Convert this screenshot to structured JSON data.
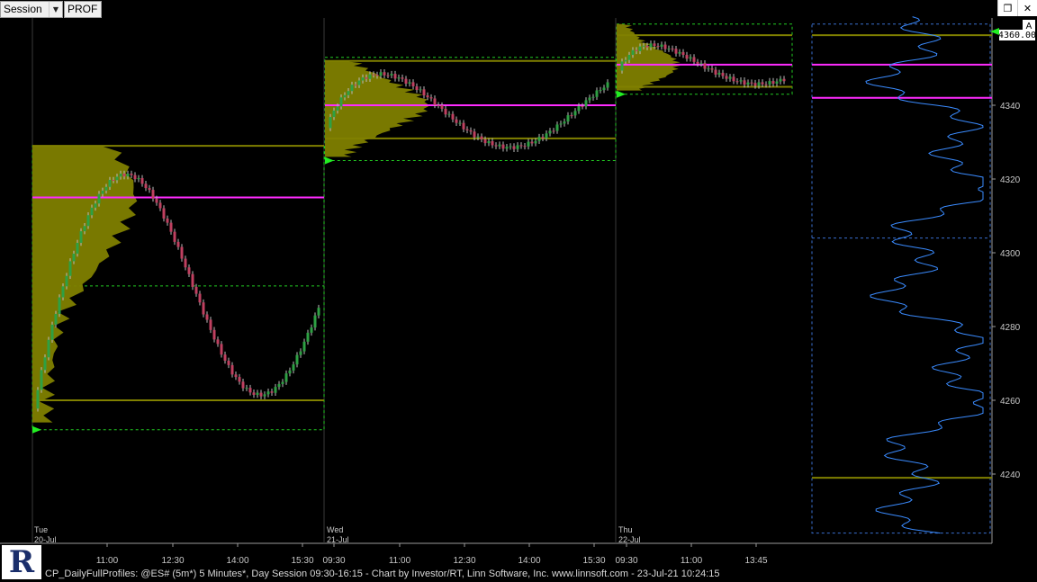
{
  "toolbar": {
    "session_label": "Session",
    "prof_label": "PROF"
  },
  "window_controls": {
    "restore_icon": "restore-icon",
    "close_icon": "close-icon"
  },
  "badge": {
    "label": "A"
  },
  "price_tag": {
    "value": "4360.00"
  },
  "footer": {
    "text": "CP_DailyFullProfiles: @ES# (5m*) 5 Minutes*, Day Session 09:30-16:15 - Chart by Investor/RT, Linn Software, Inc. www.linnsoft.com - 23-Jul-21 10:24:15"
  },
  "colors": {
    "candle_up": "#2ea043",
    "candle_down": "#c04060",
    "profile": "#808000",
    "poc": "#ff2bff",
    "value_area": "#808000",
    "range_box": "#22cc22",
    "composite": "#3a8bff"
  },
  "chart_data": {
    "type": "candlestick",
    "y_axis": {
      "ylim": [
        4222,
        4377
      ],
      "ticks": [
        "4240",
        "4260",
        "4280",
        "4300",
        "4320",
        "4340"
      ]
    },
    "x_ticks": [
      "11:00",
      "12:30",
      "14:00",
      "15:30",
      "09:30",
      "11:00",
      "12:30",
      "14:00",
      "15:30",
      "09:30",
      "11:00",
      "13:45"
    ],
    "days": [
      {
        "day": "Tue",
        "date": "20-Jul",
        "high": 4329,
        "low": 4254,
        "poc": 4315,
        "vah": 4329,
        "val": 4260,
        "range_high": 4329,
        "range_low": 4252,
        "ib_low": 4291
      },
      {
        "day": "Wed",
        "date": "21-Jul",
        "high": 4352,
        "low": 4326,
        "poc": 4340,
        "vah": 4352,
        "val": 4331,
        "range_high": 4353,
        "range_low": 4325
      },
      {
        "day": "Thu",
        "date": "22-Jul",
        "high": 4362,
        "low": 4344,
        "poc": 4351,
        "vah": 4359,
        "val": 4345,
        "range_high": 4362,
        "range_low": 4343
      }
    ],
    "composite_profile": {
      "poc_lines": [
        4351,
        4342
      ],
      "va_lines": [
        4359,
        4239
      ],
      "value_area_high": 4304
    }
  }
}
